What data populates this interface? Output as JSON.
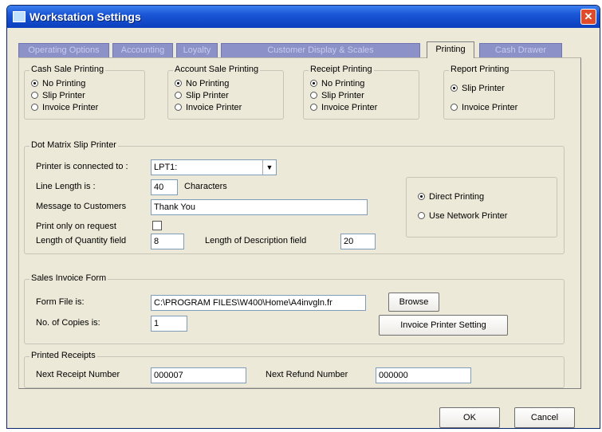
{
  "window": {
    "title": "Workstation Settings",
    "close_glyph": "✕"
  },
  "tabs": [
    {
      "label": "Operating Options",
      "active": false
    },
    {
      "label": "Accounting",
      "active": false
    },
    {
      "label": "Loyalty",
      "active": false
    },
    {
      "label": "Customer Display & Scales",
      "active": false
    },
    {
      "label": "Printing",
      "active": true
    },
    {
      "label": "Cash Drawer",
      "active": false
    }
  ],
  "printing_groups": {
    "cash_sale": {
      "title": "Cash Sale Printing",
      "options": [
        "No Printing",
        "Slip Printer",
        "Invoice Printer"
      ],
      "selected": 0
    },
    "account_sale": {
      "title": "Account Sale Printing",
      "options": [
        "No Printing",
        "Slip Printer",
        "Invoice Printer"
      ],
      "selected": 0
    },
    "receipt": {
      "title": "Receipt Printing",
      "options": [
        "No Printing",
        "Slip Printer",
        "Invoice Printer"
      ],
      "selected": 0
    },
    "report": {
      "title": "Report Printing",
      "options": [
        "Slip Printer",
        "Invoice Printer"
      ],
      "selected": 0
    }
  },
  "slip_printer": {
    "title": "Dot Matrix Slip Printer",
    "connected_label": "Printer is connected to :",
    "connected_value": "LPT1:",
    "line_length_label": "Line Length is :",
    "line_length_value": "40",
    "line_length_unit": "Characters",
    "message_label": "Message to Customers",
    "message_value": "Thank You",
    "print_only_label": "Print only on request",
    "print_only_checked": false,
    "qty_length_label": "Length of Quantity field",
    "qty_length_value": "8",
    "desc_length_label": "Length of Description field",
    "desc_length_value": "20",
    "mode_options": [
      "Direct Printing",
      "Use Network Printer"
    ],
    "mode_selected": 0
  },
  "sales_invoice": {
    "title": "Sales Invoice Form",
    "form_file_label": "Form File is:",
    "form_file_value": "C:\\PROGRAM FILES\\W400\\Home\\A4invgln.fr",
    "browse_label": "Browse",
    "copies_label": "No. of Copies is:",
    "copies_value": "1",
    "invoice_printer_label": "Invoice Printer Setting"
  },
  "printed_receipts": {
    "title": "Printed Receipts",
    "next_receipt_label": "Next Receipt Number",
    "next_receipt_value": "000007",
    "next_refund_label": "Next Refund Number",
    "next_refund_value": "000000"
  },
  "footer": {
    "ok_label": "OK",
    "cancel_label": "Cancel"
  }
}
